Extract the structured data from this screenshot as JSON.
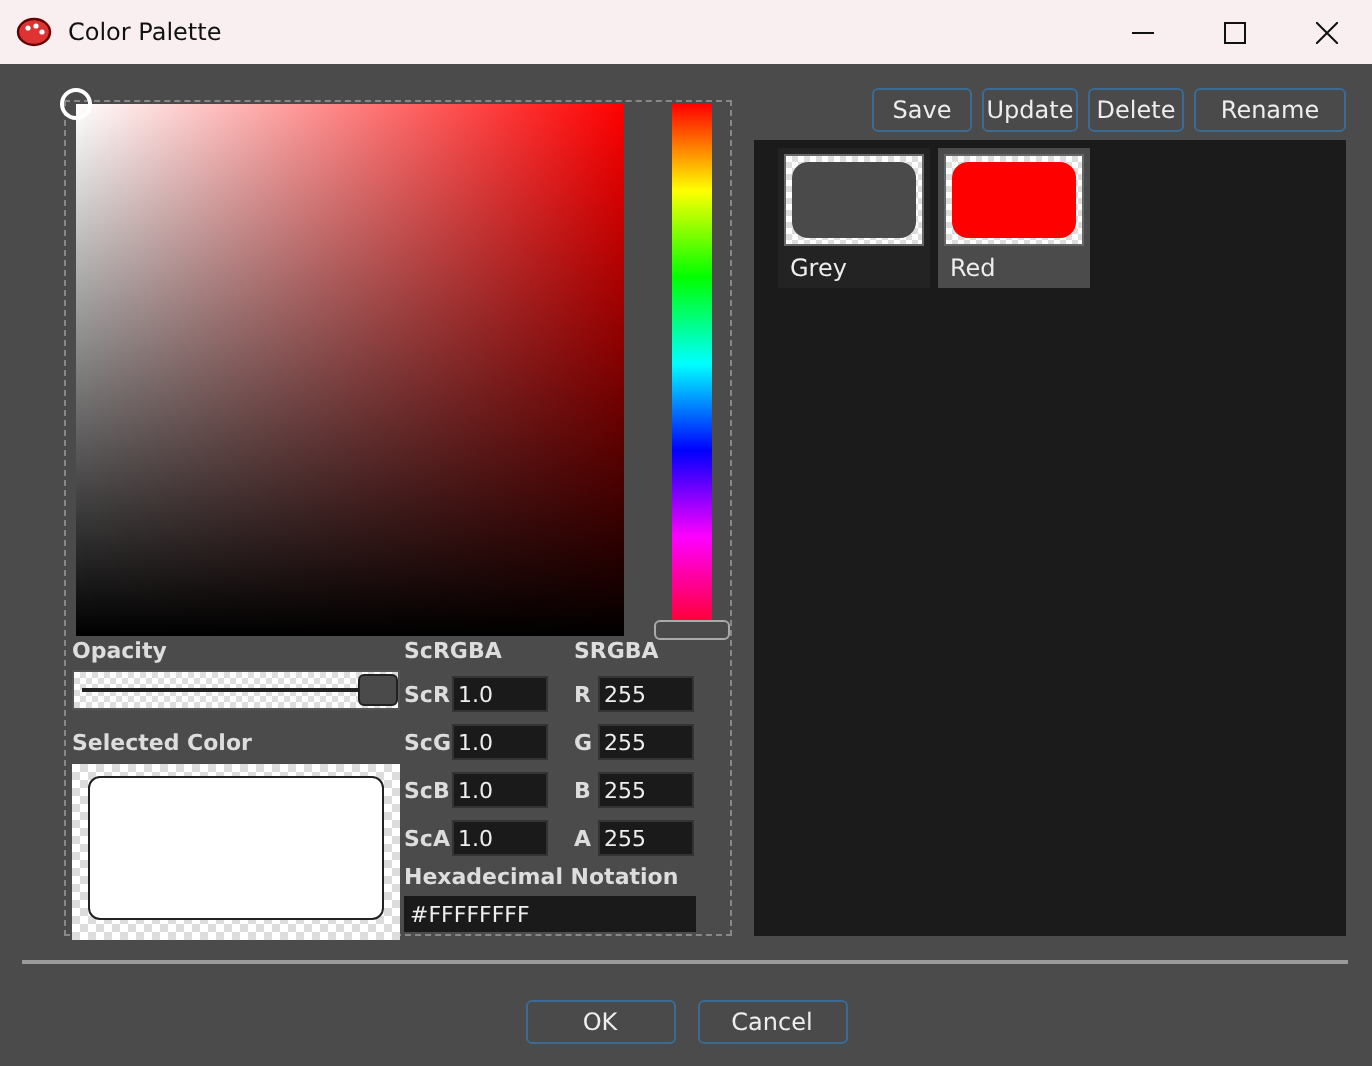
{
  "window": {
    "title": "Color Palette"
  },
  "opacity": {
    "label": "Opacity",
    "level": 1.0
  },
  "selected_color": {
    "label": "Selected Color"
  },
  "scrgba": {
    "heading": "ScRGBA",
    "fields": [
      {
        "label": "ScR",
        "value": "1.0"
      },
      {
        "label": "ScG",
        "value": "1.0"
      },
      {
        "label": "ScB",
        "value": "1.0"
      },
      {
        "label": "ScA",
        "value": "1.0"
      }
    ]
  },
  "srgba": {
    "heading": "SRGBA",
    "fields": [
      {
        "label": "R",
        "value": "255"
      },
      {
        "label": "G",
        "value": "255"
      },
      {
        "label": "B",
        "value": "255"
      },
      {
        "label": "A",
        "value": "255"
      }
    ]
  },
  "hex": {
    "label": "Hexadecimal Notation",
    "value": "#FFFFFFFF"
  },
  "palette_buttons": [
    "Save",
    "Update",
    "Delete",
    "Rename"
  ],
  "swatches": [
    {
      "name": "Grey",
      "color": "#4a4a4a",
      "selected": false
    },
    {
      "name": "Red",
      "color": "#ff0000",
      "selected": true
    }
  ],
  "buttons": [
    "OK",
    "Cancel"
  ]
}
